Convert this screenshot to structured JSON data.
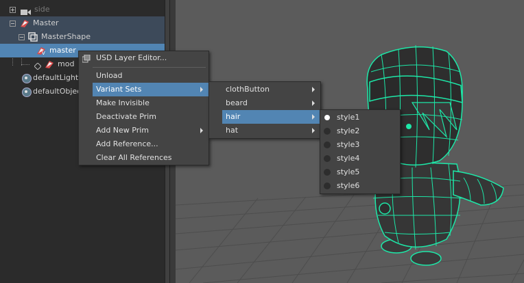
{
  "outliner": {
    "rows": [
      {
        "label": "side"
      },
      {
        "label": "Master"
      },
      {
        "label": "MasterShape"
      },
      {
        "label": "master"
      },
      {
        "label": "mod"
      },
      {
        "label": "defaultLightSet"
      },
      {
        "label": "defaultObjectSet"
      }
    ]
  },
  "context_menu": {
    "items": [
      {
        "label": "USD Layer Editor..."
      },
      {
        "label": "Unload"
      },
      {
        "label": "Variant Sets"
      },
      {
        "label": "Make Invisible"
      },
      {
        "label": "Deactivate Prim"
      },
      {
        "label": "Add New Prim"
      },
      {
        "label": "Add Reference..."
      },
      {
        "label": "Clear All References"
      }
    ]
  },
  "variant_sets_menu": {
    "items": [
      {
        "label": "clothButton"
      },
      {
        "label": "beard"
      },
      {
        "label": "hair"
      },
      {
        "label": "hat"
      }
    ]
  },
  "hair_menu": {
    "items": [
      {
        "label": "style1",
        "selected": true
      },
      {
        "label": "style2",
        "selected": false
      },
      {
        "label": "style3",
        "selected": false
      },
      {
        "label": "style4",
        "selected": false
      },
      {
        "label": "style5",
        "selected": false
      },
      {
        "label": "style6",
        "selected": false
      }
    ]
  },
  "colors": {
    "selection": "#5285b3",
    "wireframe": "#1de8a8",
    "menu_bg": "#444444"
  }
}
